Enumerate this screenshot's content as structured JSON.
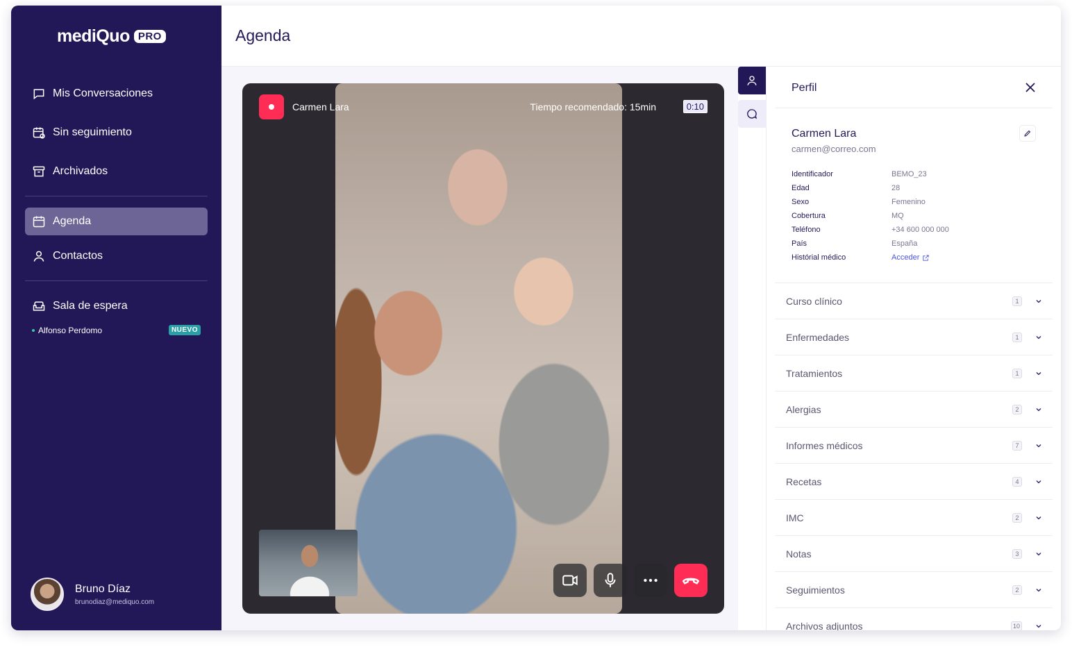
{
  "brand": {
    "name": "mediQuo",
    "badge": "PRO"
  },
  "sidebar": {
    "items": [
      {
        "label": "Mis Conversaciones",
        "icon": "chat-icon"
      },
      {
        "label": "Sin seguimiento",
        "icon": "calendar-followup-icon"
      },
      {
        "label": "Archivados",
        "icon": "archive-icon"
      },
      {
        "label": "Agenda",
        "icon": "calendar-icon",
        "active": true
      },
      {
        "label": "Contactos",
        "icon": "person-icon"
      },
      {
        "label": "Sala de espera",
        "icon": "sofa-icon"
      }
    ],
    "waiting": {
      "patient": "Alfonso Perdomo",
      "badge": "NUEVO"
    },
    "user": {
      "name": "Bruno Díaz",
      "email": "brunodiaz@mediquo.com"
    }
  },
  "header": {
    "title": "Agenda"
  },
  "call": {
    "patient_name": "Carmen Lara",
    "recommended_label": "Tiempo recomendado: 15min",
    "timer": "0:10",
    "controls": [
      "camera-icon",
      "microphone-icon",
      "more-icon",
      "end-call-icon"
    ]
  },
  "profile": {
    "title": "Perfil",
    "name": "Carmen Lara",
    "email": "carmen@correo.com",
    "fields": [
      {
        "key": "Identificador",
        "value": "BEMO_23"
      },
      {
        "key": "Edad",
        "value": "28"
      },
      {
        "key": "Sexo",
        "value": "Femenino"
      },
      {
        "key": "Cobertura",
        "value": "MQ"
      },
      {
        "key": "Teléfono",
        "value": "+34 600 000 000"
      },
      {
        "key": "País",
        "value": "España"
      },
      {
        "key": "Histórial médico",
        "value": "Acceder"
      }
    ],
    "sections": [
      {
        "label": "Curso clínico",
        "count": "1"
      },
      {
        "label": "Enfermedades",
        "count": "1"
      },
      {
        "label": "Tratamientos",
        "count": "1"
      },
      {
        "label": "Alergias",
        "count": "2"
      },
      {
        "label": "Informes médicos",
        "count": "7"
      },
      {
        "label": "Recetas",
        "count": "4"
      },
      {
        "label": "IMC",
        "count": "2"
      },
      {
        "label": "Notas",
        "count": "3"
      },
      {
        "label": "Seguimientos",
        "count": "2"
      },
      {
        "label": "Archivos adjuntos",
        "count": "10"
      }
    ]
  },
  "colors": {
    "sidebar": "#231857",
    "accent": "#ff2d55",
    "link": "#4a56e2",
    "new_badge": "#2aa0a6"
  }
}
